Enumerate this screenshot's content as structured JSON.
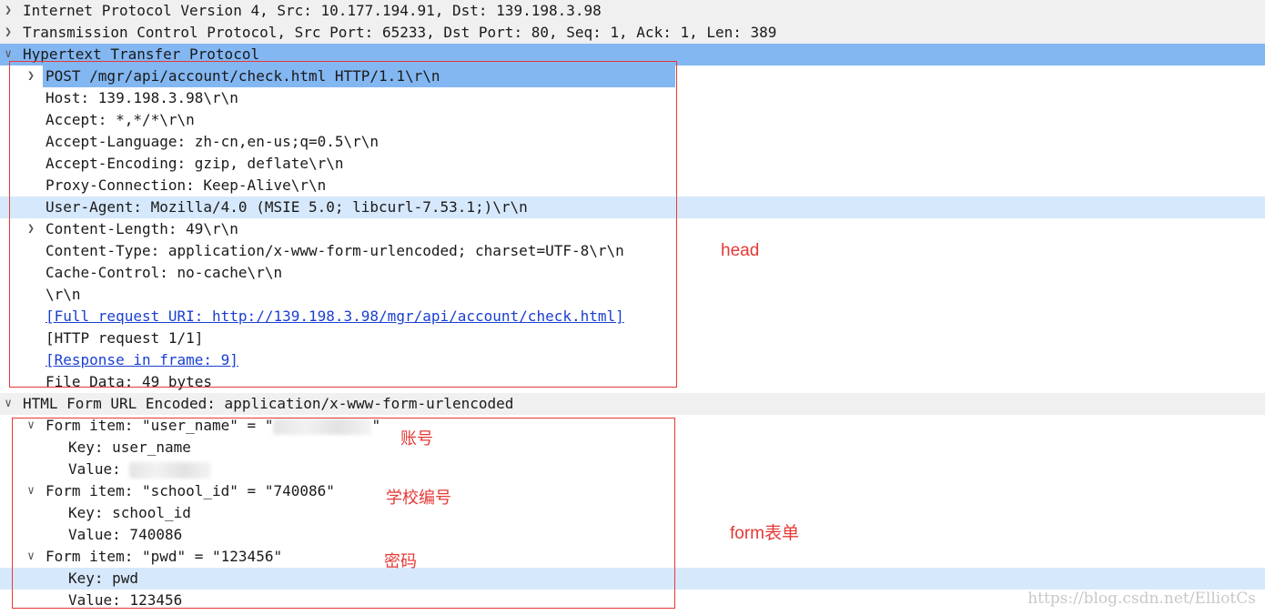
{
  "tree": {
    "ip": {
      "label": "Internet Protocol Version 4, Src: 10.177.194.91, Dst: 139.198.3.98"
    },
    "tcp": {
      "label": "Transmission Control Protocol, Src Port: 65233, Dst Port: 80, Seq: 1, Ack: 1, Len: 389"
    },
    "http": {
      "label": "Hypertext Transfer Protocol",
      "request_line": "POST /mgr/api/account/check.html HTTP/1.1\\r\\n",
      "host": "Host: 139.198.3.98\\r\\n",
      "accept": "Accept: *,*/*\\r\\n",
      "accept_language": "Accept-Language: zh-cn,en-us;q=0.5\\r\\n",
      "accept_encoding": "Accept-Encoding: gzip, deflate\\r\\n",
      "proxy_connection": "Proxy-Connection: Keep-Alive\\r\\n",
      "user_agent": "User-Agent: Mozilla/4.0 (MSIE 5.0; libcurl-7.53.1;)\\r\\n",
      "content_length": "Content-Length: 49\\r\\n",
      "content_type": "Content-Type: application/x-www-form-urlencoded; charset=UTF-8\\r\\n",
      "cache_control": "Cache-Control: no-cache\\r\\n",
      "crlf": "\\r\\n",
      "full_uri": "[Full request URI: http://139.198.3.98/mgr/api/account/check.html]",
      "request_num": "[HTTP request 1/1]",
      "response_frame": "[Response in frame: 9]",
      "file_data": "File Data: 49 bytes"
    },
    "form": {
      "label": "HTML Form URL Encoded: application/x-www-form-urlencoded",
      "items": [
        {
          "label": "Form item: \"user_name\" = \"",
          "label_end": "\"",
          "key": "Key: user_name",
          "value": "Value: "
        },
        {
          "label": "Form item: \"school_id\" = \"740086\"",
          "key": "Key: school_id",
          "value": "Value: 740086"
        },
        {
          "label": "Form item: \"pwd\" = \"123456\"",
          "key": "Key: pwd",
          "value": "Value: 123456"
        }
      ]
    }
  },
  "annotations": {
    "head": "head",
    "account": "账号",
    "school": "学校编号",
    "password": "密码",
    "form": "form表单"
  },
  "watermark": "https://blog.csdn.net/ElliotCs",
  "colors": {
    "selected": "#83b7f2",
    "highlight": "#d6e8fb",
    "annotation": "#e53935",
    "link": "#1a3fd1"
  }
}
